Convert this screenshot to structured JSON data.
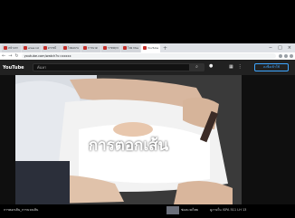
{
  "browser": {
    "tabs": [
      {
        "title": "หน้าแรก"
      },
      {
        "title": "www.nstda"
      },
      {
        "title": "ดรรชนี"
      },
      {
        "title": "ไทยอบรม"
      },
      {
        "title": "การนวด"
      },
      {
        "title": "ราชพฤกษ์"
      },
      {
        "title": "ไทย Massage"
      },
      {
        "title": "YouTube"
      }
    ],
    "active_tab_index": 7,
    "new_tab_glyph": "+",
    "window_controls": [
      "−",
      "□",
      "×"
    ],
    "url": "youtube.com/watch?v=xxxxx"
  },
  "youtube": {
    "logo": "YouTube",
    "search_placeholder": "ค้นหา",
    "signin_label": "ลงชื่อเข้าใช้"
  },
  "video": {
    "caption": "การตอกเส้น",
    "title": "การตอกเส้น_การนวดเส้น",
    "channel": "ช่องนวดไทย",
    "sub_info": "ดูภายใน ISPA 511 LH 13"
  },
  "icons": {
    "back": "back-arrow-icon",
    "forward": "forward-arrow-icon",
    "reload": "reload-icon",
    "search": "search-icon",
    "mic": "mic-icon",
    "apps": "apps-grid-icon",
    "more": "more-vert-icon"
  }
}
